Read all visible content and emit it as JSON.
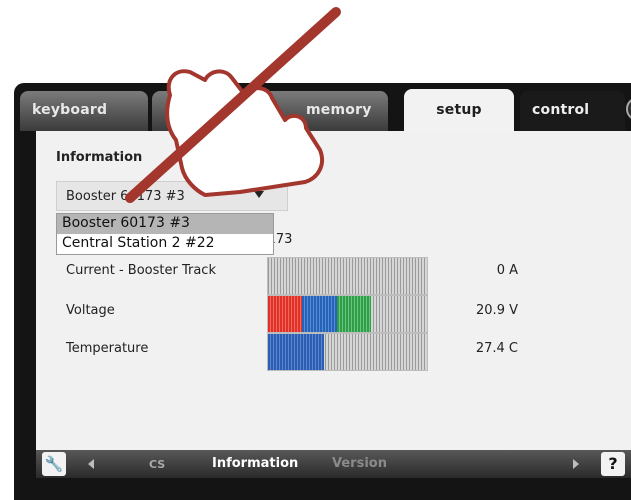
{
  "tabs": [
    {
      "label": "keyboard"
    },
    {
      "label": ""
    },
    {
      "label": "memory"
    },
    {
      "label": "setup"
    },
    {
      "label": "control"
    }
  ],
  "panel": {
    "section_title": "Information",
    "select_value": "Booster 60173 #3",
    "device_id": "60173",
    "dropdown_options": [
      "Booster 60173 #3",
      "Central Station 2 #22"
    ],
    "rows": [
      {
        "label": "Current - Booster Track",
        "value": "0 A",
        "level": 0
      },
      {
        "label": "Voltage",
        "value": "20.9 V",
        "level": 0.65
      },
      {
        "label": "Temperature",
        "value": "27.4 C",
        "level": 0.35
      }
    ]
  },
  "bottom_bar": {
    "nav_items": [
      "CS",
      "Information",
      "Version"
    ],
    "help_label": "?",
    "tool_icon": "wrench-icon"
  },
  "colors": {
    "voltage_segments": [
      "#e1302a",
      "#2563b8",
      "#2e9e48"
    ],
    "temperature_fill": "#2d5db2",
    "overlay_pen": "#a3362d"
  }
}
